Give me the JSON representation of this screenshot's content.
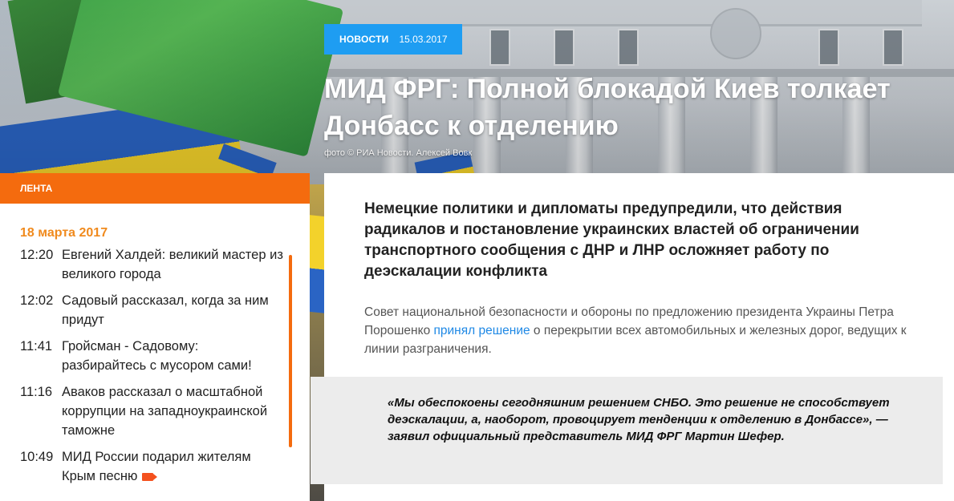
{
  "article": {
    "category": "НОВОСТИ",
    "date": "15.03.2017",
    "headline": "МИД ФРГ: Полной блокадой Киев толкает Донбасс к отделению",
    "photo_credit": "фото © РИА Новости. Алексей Вовк",
    "lead": "Немецкие политики и дипломаты предупредили, что действия радикалов и постановление украинских властей об ограничении транспортного сообщения с ДНР и ЛНР осложняет работу по деэскалации конфликта",
    "body_before_link": "Совет национальной безопасности и обороны по предложению президента Украины Петра Порошенко ",
    "body_link": "принял решение",
    "body_after_link": " о перекрытии всех автомобильных и железных дорог, ведущих к линии разграничения.",
    "quote": "«Мы обеспокоены сегодняшним решением СНБО. Это решение не способствует деэскалации, а, наоборот, провоцирует тенденции к отделению в Донбассе», — заявил официальный представитель МИД ФРГ Мартин Шефер."
  },
  "feed": {
    "header": "ЛЕНТА",
    "date": "18 марта 2017",
    "items": [
      {
        "time": "12:20",
        "title": "Евгений Халдей: великий мастер из великого города"
      },
      {
        "time": "12:02",
        "title": "Садовый рассказал, когда за ним придут"
      },
      {
        "time": "11:41",
        "title": "Гройсман - Садовому: разбирайтесь с мусором сами!"
      },
      {
        "time": "11:16",
        "title": "Аваков рассказал о масштабной коррупции на западноукраинской таможне"
      },
      {
        "time": "10:49",
        "title": "МИД России подарил жителям Крым песню",
        "icon": "video-icon"
      }
    ]
  },
  "colors": {
    "category_badge": "#1e9df2",
    "feed_accent": "#f46b0e",
    "feed_date": "#f08a1d",
    "link": "#1e88e5",
    "quote_bg": "#ececec"
  }
}
